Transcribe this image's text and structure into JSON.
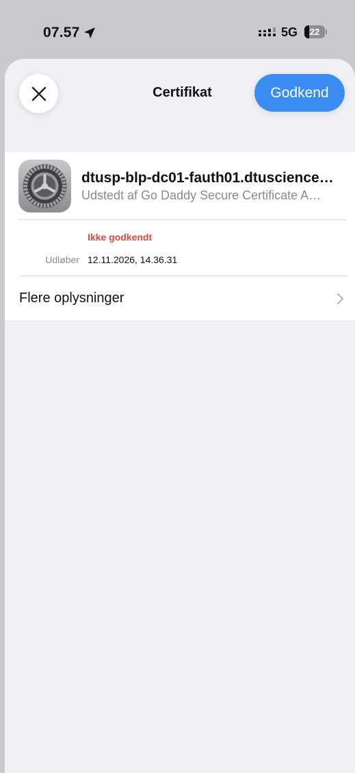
{
  "status_bar": {
    "time": "07.57",
    "network": "5G",
    "battery_level": 22,
    "battery_text": "22",
    "icons": [
      "location-arrow-icon",
      "signal-icon",
      "battery-icon"
    ]
  },
  "sheet": {
    "title": "Certifikat",
    "close_icon": "close-icon",
    "approve_label": "Godkend",
    "accent_color": "#3a8cf3"
  },
  "certificate": {
    "icon": "settings-gear-icon",
    "name": "dtusp-blp-dc01-fauth01.dtuscience…",
    "issuer": "Udstedt af Go Daddy Secure Certificate A…",
    "status": "Ikke godkendt",
    "status_color": "#e0463d",
    "expires_label": "Udløber",
    "expires_value": "12.11.2026, 14.36.31"
  },
  "more_info": {
    "label": "Flere oplysninger",
    "icon": "chevron-right-icon"
  }
}
